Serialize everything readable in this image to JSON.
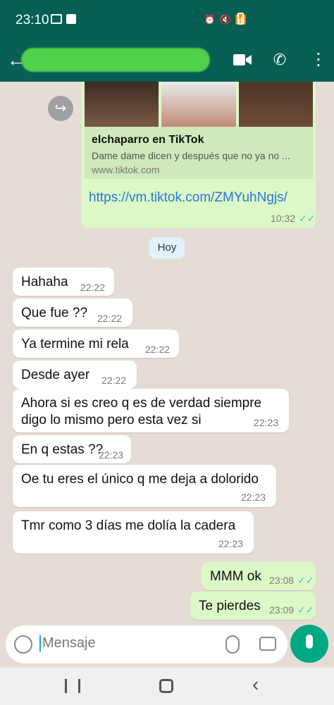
{
  "status_bar": {
    "time": "23:10",
    "network_label": ""
  },
  "header": {
    "contact_name": ""
  },
  "link_preview": {
    "title": "elchaparro en TikTok",
    "description": "Dame dame dicen y después que no ya no ...",
    "domain": "www.tiktok.com",
    "url": "https://vm.tiktok.com/ZMYuhNgjs/",
    "time": "10:32",
    "ticks": "✓✓"
  },
  "date_separator": "Hoy",
  "messages": [
    {
      "text": "Hahaha",
      "time": "22:22"
    },
    {
      "text": "Que fue ??",
      "time": "22:22"
    },
    {
      "text": "Ya termine mi rela",
      "time": "22:22"
    },
    {
      "text": "Desde ayer",
      "time": "22:22"
    },
    {
      "text": [
        "Ahora si es creo q es de verdad siempre",
        "digo lo mismo pero esta vez si"
      ],
      "time": "22:23"
    },
    {
      "text": "En q estas ??",
      "time": "22:23"
    },
    {
      "text": "Oe tu eres el único q me deja a dolorido",
      "time": "22:23"
    },
    {
      "text": "Tmr como 3 días me dolía la cadera",
      "time": "22:23"
    }
  ],
  "outgoing": [
    {
      "text": "MMM ok",
      "time": "23:08",
      "ticks": "✓✓"
    },
    {
      "text": "Te pierdes",
      "time": "23:09",
      "ticks": "✓✓"
    }
  ],
  "input": {
    "placeholder": "Mensaje"
  },
  "icons": {
    "back": "arrow-left-icon",
    "video": "video-icon",
    "call": "phone-icon",
    "menu": "more-vert-icon",
    "forward": "forward-icon",
    "emoji": "emoji-icon",
    "attach": "paperclip-icon",
    "camera": "camera-icon",
    "mic": "mic-icon"
  },
  "colors": {
    "appbar": "#075e54",
    "incoming": "#ffffff",
    "outgoing": "#dcf8c6",
    "accent": "#00a884",
    "link": "#2878d3"
  }
}
